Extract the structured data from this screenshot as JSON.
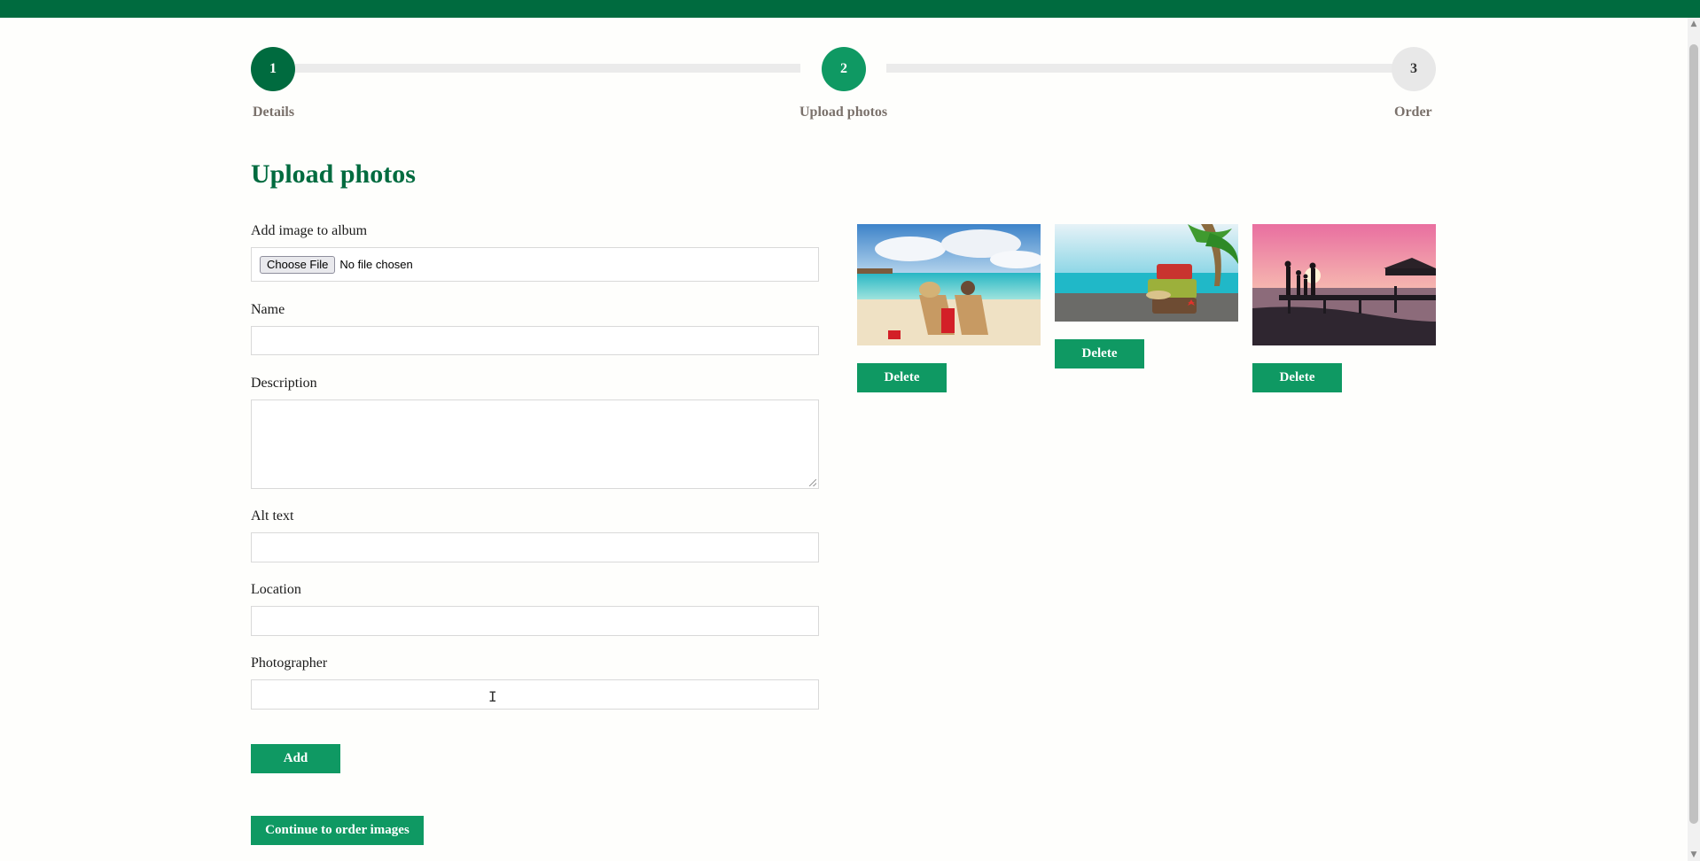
{
  "steps": [
    {
      "number": "1",
      "label": "Details",
      "color": "#006b3f"
    },
    {
      "number": "2",
      "label": "Upload photos",
      "color": "#0f9963"
    },
    {
      "number": "3",
      "label": "Order",
      "color": "#e8e8e8"
    }
  ],
  "page_title": "Upload photos",
  "form": {
    "image_label": "Add image to album",
    "choose_file_label": "Choose File",
    "file_status": "No file chosen",
    "name_label": "Name",
    "name_value": "",
    "description_label": "Description",
    "description_value": "",
    "alt_label": "Alt text",
    "alt_value": "",
    "location_label": "Location",
    "location_value": "",
    "photographer_label": "Photographer",
    "photographer_value": "",
    "add_label": "Add",
    "continue_label": "Continue to order images"
  },
  "gallery": [
    {
      "image": "beach-loungers-photo",
      "delete_label": "Delete"
    },
    {
      "image": "suitcases-palm-photo",
      "delete_label": "Delete"
    },
    {
      "image": "sunset-pier-family-photo",
      "delete_label": "Delete"
    }
  ],
  "colors": {
    "brand": "#006b3f",
    "button": "#0f9963",
    "background": "#fefefc"
  }
}
